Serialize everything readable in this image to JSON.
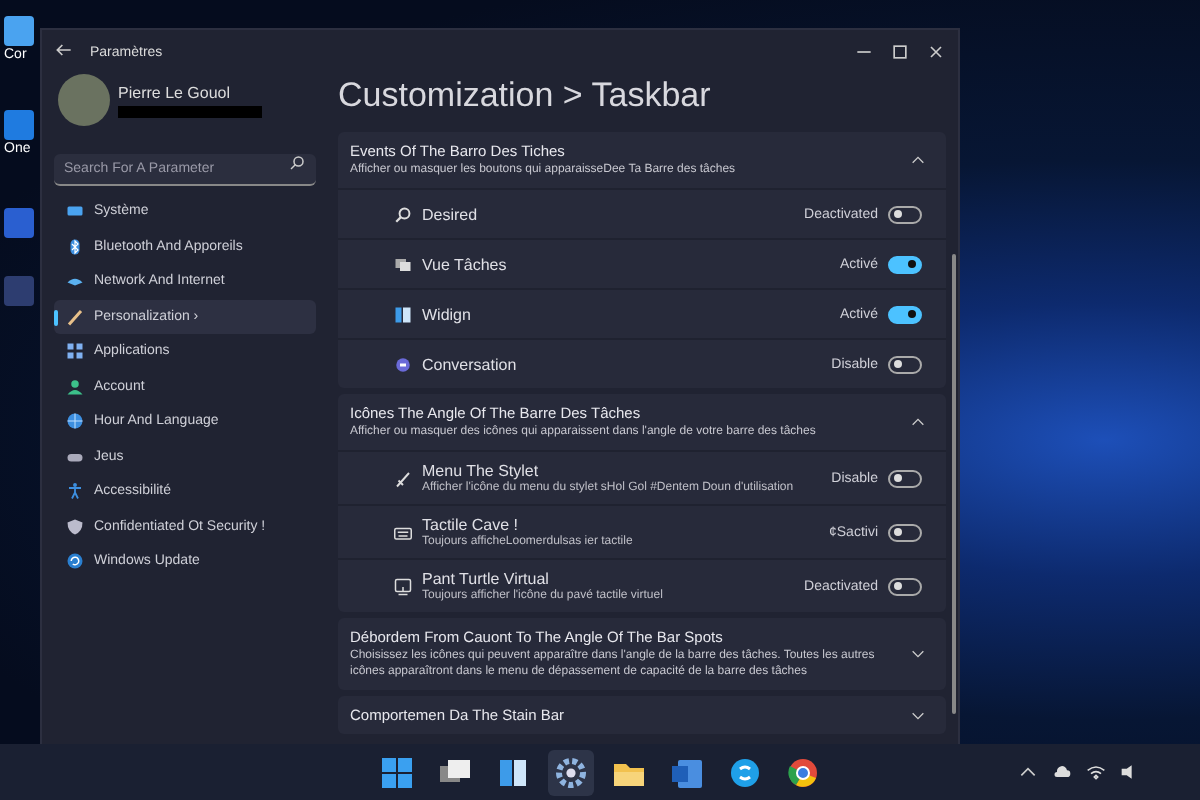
{
  "desktop_icons": [
    {
      "label": "Cor"
    },
    {
      "label": "One"
    }
  ],
  "window": {
    "title": "Paramètres"
  },
  "user": {
    "name": "Pierre Le Gouol"
  },
  "search": {
    "placeholder": "Search For A Parameter"
  },
  "sidebar": {
    "items": [
      {
        "label": "Système",
        "selected": false
      },
      {
        "label": "Bluetooth And Apporeils",
        "selected": false
      },
      {
        "label": "Network And Internet",
        "selected": false
      },
      {
        "label": "Personalization ›",
        "selected": true
      },
      {
        "label": "Applications",
        "selected": false
      },
      {
        "label": "Account",
        "selected": false
      },
      {
        "label": "Hour And Language",
        "selected": false
      },
      {
        "label": "Jeus",
        "selected": false
      },
      {
        "label": "Accessibilité",
        "selected": false
      },
      {
        "label": "Confidentiated Ot Security !",
        "selected": false
      },
      {
        "label": "Windows Update",
        "selected": false
      }
    ]
  },
  "page_title": "Customization > Taskbar",
  "sections": [
    {
      "title": "Events Of The Barro Des Tiches",
      "description": "Afficher ou masquer les boutons qui apparaisseDee Ta Barre des tâches",
      "expanded": true,
      "items": [
        {
          "label": "Desired",
          "status": "Deactivated",
          "on": false
        },
        {
          "label": "Vue Tâches",
          "status": "Activé",
          "on": true
        },
        {
          "label": "Widign",
          "status": "Activé",
          "on": true
        },
        {
          "label": "Conversation",
          "status": "Disable",
          "on": false
        }
      ]
    },
    {
      "title": "Icônes The Angle Of The Barre Des Tâches",
      "description": "Afficher ou masquer des icônes qui apparaissent dans l'angle de votre barre des tâches",
      "expanded": true,
      "items": [
        {
          "label": "Menu The Stylet",
          "description": "Afficher l'icône du menu du stylet sHol Gol #Dentem Doun d'utilisation",
          "status": "Disable",
          "on": false
        },
        {
          "label": "Tactile Cave !",
          "description": "Toujours afficheLoomerdulsas ier tactile",
          "status": "¢Sactivi",
          "on": false
        },
        {
          "label": "Pant Turtle Virtual",
          "description": "Toujours afficher l'icône du pavé tactile virtuel",
          "status": "Deactivated",
          "on": false
        }
      ]
    },
    {
      "title": "Débordem From Cauont To The Angle Of The Bar Spots",
      "description": "Choisissez les icônes qui peuvent apparaître dans l'angle de la barre des tâches. Toutes les autres icônes apparaîtront dans le menu de dépassement de capacité de la barre des tâches",
      "expanded": false
    },
    {
      "title": "Comportemen Da The Stain Bar",
      "expanded": false
    }
  ]
}
